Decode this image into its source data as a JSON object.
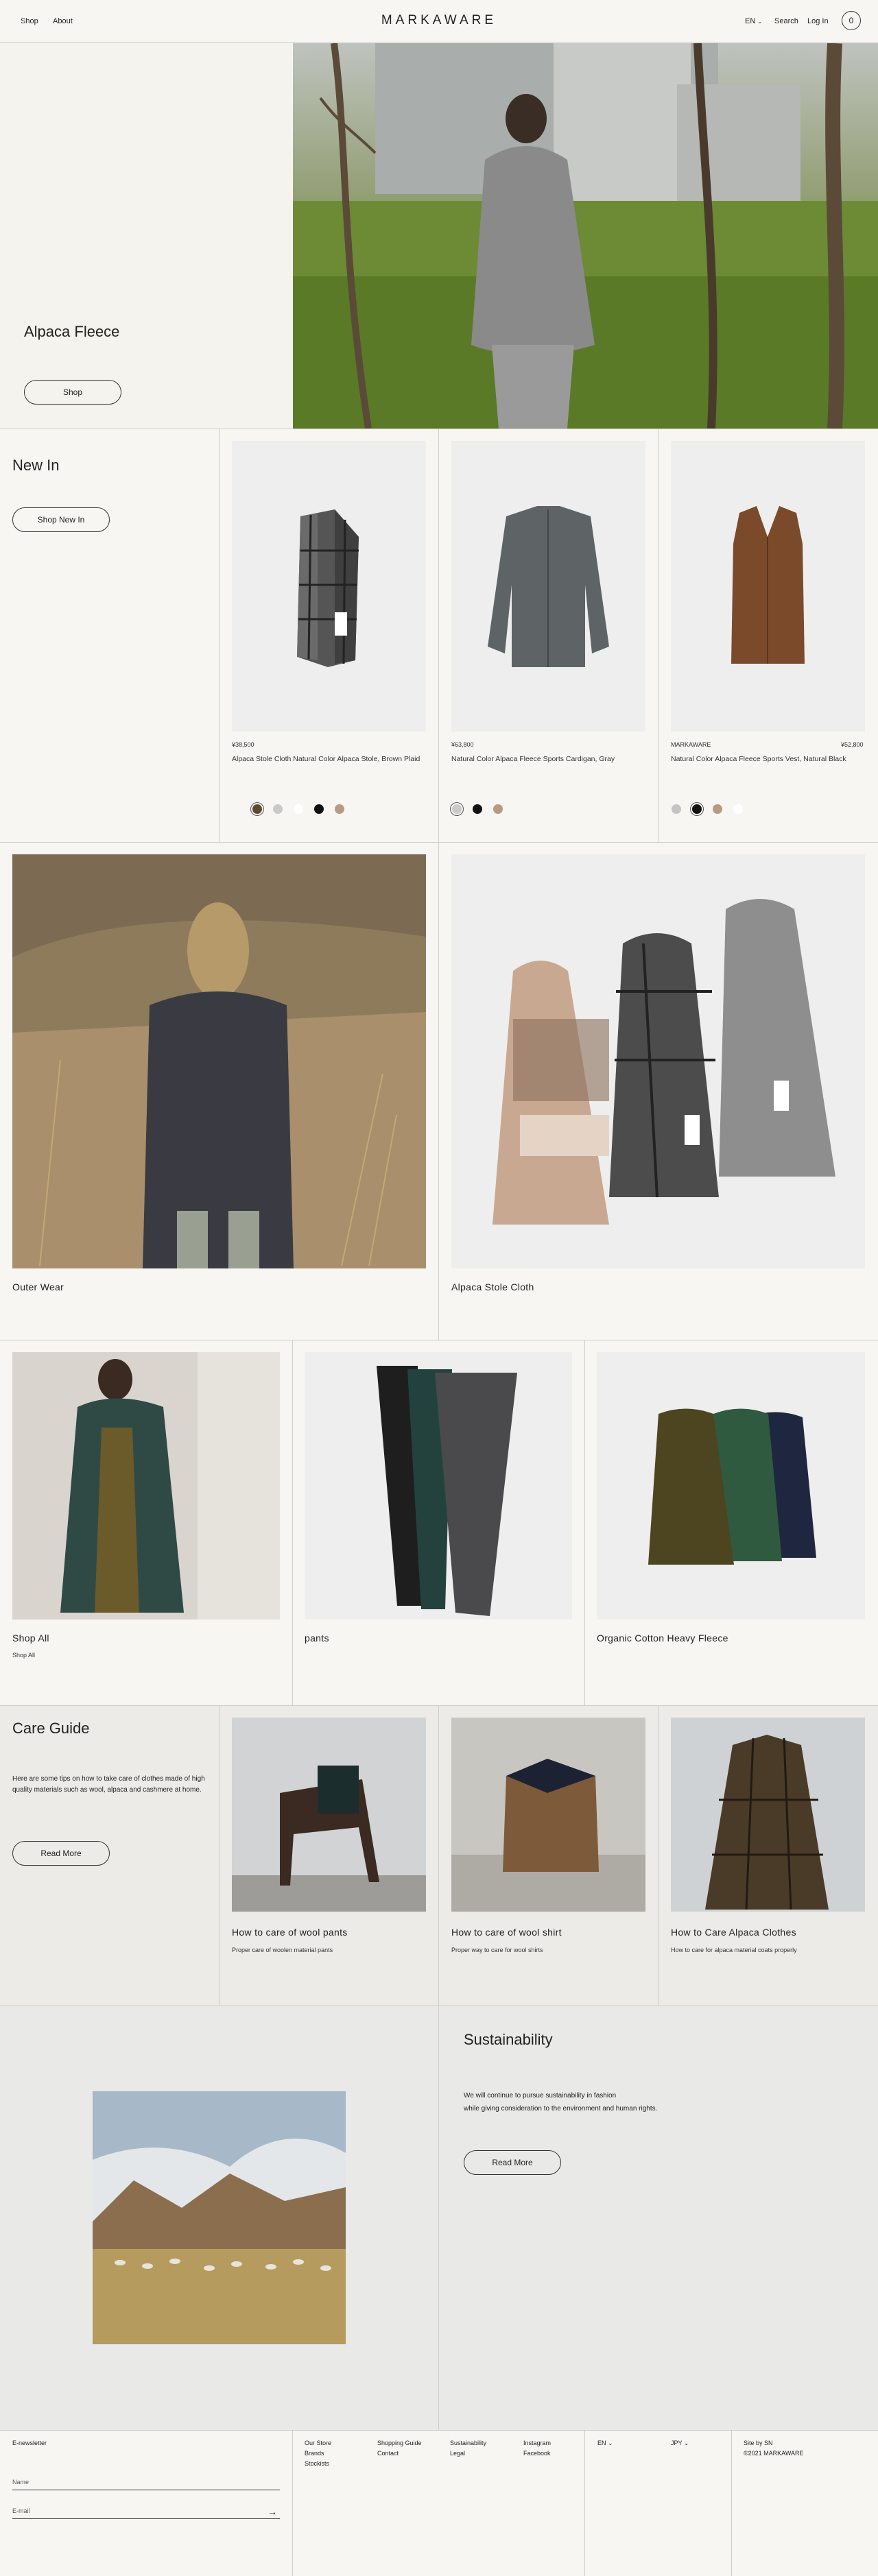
{
  "header": {
    "nav": [
      "Shop",
      "About"
    ],
    "logo": "MARKAWARE",
    "lang": "EN",
    "search": "Search",
    "login": "Log In",
    "cart_count": "0"
  },
  "hero": {
    "title": "Alpaca Fleece",
    "button": "Shop"
  },
  "new_in": {
    "title": "New In",
    "button": "Shop New In",
    "products": [
      {
        "brand": "",
        "price": "¥38,500",
        "name": "Alpaca Stole Cloth Natural Color Alpaca Stole, Brown Plaid",
        "swatches": [
          "#5b4a30",
          "#c9c9c9",
          "#ffffff",
          "#111111",
          "#b89a82"
        ],
        "selected": 0
      },
      {
        "brand": "",
        "price": "¥63,800",
        "name": "Natural Color Alpaca Fleece Sports Cardigan, Gray",
        "swatches": [
          "#c9c9c9",
          "#111111",
          "#b89a82"
        ],
        "selected": 0
      },
      {
        "brand": "MARKAWARE",
        "price": "¥52,800",
        "name": "Natural Color Alpaca Fleece Sports Vest, Natural Black",
        "swatches": [
          "#c4c4c4",
          "#111111",
          "#b89a82",
          "#ffffff"
        ],
        "selected": 1
      }
    ]
  },
  "features": [
    {
      "caption": "Outer Wear"
    },
    {
      "caption": "Alpaca Stole Cloth"
    }
  ],
  "categories": [
    {
      "caption": "Shop All",
      "sub": "Shop All"
    },
    {
      "caption": "pants",
      "sub": ""
    },
    {
      "caption": "Organic Cotton Heavy Fleece",
      "sub": ""
    }
  ],
  "care": {
    "title": "Care Guide",
    "text": "Here are some tips on how to take care of clothes made of high quality materials such as wool, alpaca and cashmere at home.",
    "button": "Read More",
    "articles": [
      {
        "title": "How to care of wool pants",
        "sub": "Proper care of woolen material pants"
      },
      {
        "title": "How to care of wool shirt",
        "sub": "Proper way to care for wool shirts"
      },
      {
        "title": "How to Care Alpaca Clothes",
        "sub": "How to care for alpaca material coats properly"
      }
    ]
  },
  "sustainability": {
    "title": "Sustainability",
    "text1": "We will continue to pursue sustainability in fashion",
    "text2": "while giving consideration to the environment and human rights.",
    "button": "Read More"
  },
  "footer": {
    "newsletter": "E-newsletter",
    "name_label": "Name",
    "email_label": "E-mail",
    "col1": [
      "Our Store",
      "Brands",
      "Stockists"
    ],
    "col2": [
      "Shopping Guide",
      "Contact"
    ],
    "col3": [
      "Sustainability",
      "Legal"
    ],
    "col4": [
      "Instagram",
      "Facebook"
    ],
    "lang": "EN",
    "currency": "JPY",
    "credit": "Site by SN",
    "copyright": "©2021 MARKAWARE"
  }
}
